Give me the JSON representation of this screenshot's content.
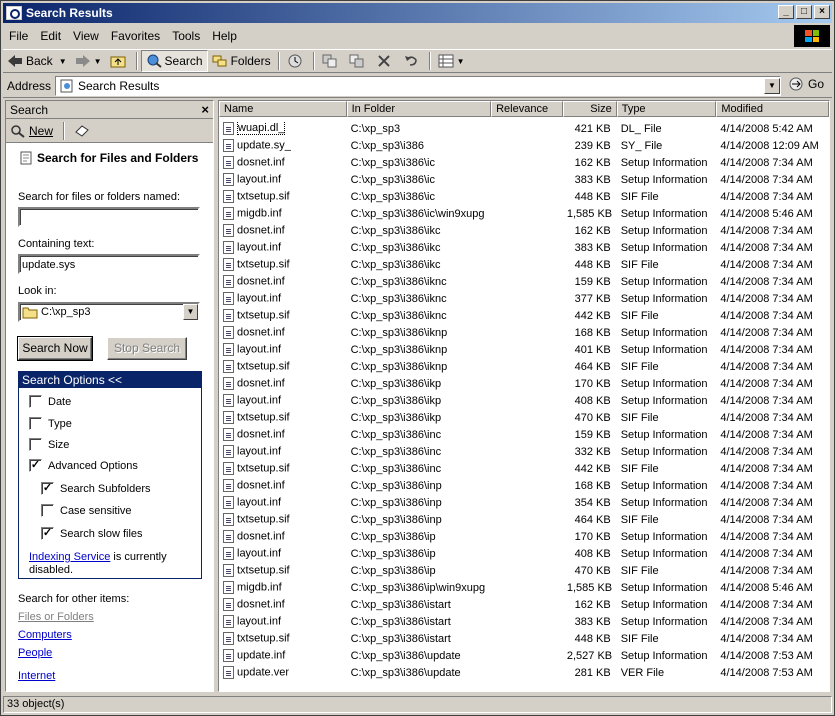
{
  "window": {
    "title": "Search Results"
  },
  "menu": [
    "File",
    "Edit",
    "View",
    "Favorites",
    "Tools",
    "Help"
  ],
  "toolbar": {
    "back": "Back",
    "search": "Search",
    "folders": "Folders"
  },
  "address": {
    "label": "Address",
    "value": "Search Results",
    "go": "Go"
  },
  "search_pane": {
    "title": "Search",
    "new_label": "New",
    "heading": "Search for Files and Folders",
    "name_label": "Search for files or folders named:",
    "name_value": "",
    "containing_label": "Containing text:",
    "containing_value": "update.sys",
    "lookin_label": "Look in:",
    "lookin_value": "C:\\xp_sp3",
    "search_now": "Search Now",
    "stop_search": "Stop Search",
    "options_title": "Search Options <<",
    "options": [
      {
        "label": "Date",
        "checked": false
      },
      {
        "label": "Type",
        "checked": false
      },
      {
        "label": "Size",
        "checked": false
      },
      {
        "label": "Advanced Options",
        "checked": true
      }
    ],
    "advanced": [
      {
        "label": "Search Subfolders",
        "checked": true
      },
      {
        "label": "Case sensitive",
        "checked": false
      },
      {
        "label": "Search slow files",
        "checked": true
      }
    ],
    "indexing_link": "Indexing Service",
    "indexing_text": " is currently disabled.",
    "other_label": "Search for other items:",
    "other_items": [
      "Files or Folders",
      "Computers",
      "People",
      "Internet"
    ]
  },
  "columns": [
    "Name",
    "In Folder",
    "Relevance",
    "Size",
    "Type",
    "Modified"
  ],
  "files": [
    [
      "wuapi.dl_",
      "C:\\xp_sp3",
      "",
      "421 KB",
      "DL_ File",
      "4/14/2008 5:42 AM"
    ],
    [
      "update.sy_",
      "C:\\xp_sp3\\i386",
      "",
      "239 KB",
      "SY_ File",
      "4/14/2008 12:09 AM"
    ],
    [
      "dosnet.inf",
      "C:\\xp_sp3\\i386\\ic",
      "",
      "162 KB",
      "Setup Information",
      "4/14/2008 7:34 AM"
    ],
    [
      "layout.inf",
      "C:\\xp_sp3\\i386\\ic",
      "",
      "383 KB",
      "Setup Information",
      "4/14/2008 7:34 AM"
    ],
    [
      "txtsetup.sif",
      "C:\\xp_sp3\\i386\\ic",
      "",
      "448 KB",
      "SIF File",
      "4/14/2008 7:34 AM"
    ],
    [
      "migdb.inf",
      "C:\\xp_sp3\\i386\\ic\\win9xupg",
      "",
      "1,585 KB",
      "Setup Information",
      "4/14/2008 5:46 AM"
    ],
    [
      "dosnet.inf",
      "C:\\xp_sp3\\i386\\ikc",
      "",
      "162 KB",
      "Setup Information",
      "4/14/2008 7:34 AM"
    ],
    [
      "layout.inf",
      "C:\\xp_sp3\\i386\\ikc",
      "",
      "383 KB",
      "Setup Information",
      "4/14/2008 7:34 AM"
    ],
    [
      "txtsetup.sif",
      "C:\\xp_sp3\\i386\\ikc",
      "",
      "448 KB",
      "SIF File",
      "4/14/2008 7:34 AM"
    ],
    [
      "dosnet.inf",
      "C:\\xp_sp3\\i386\\iknc",
      "",
      "159 KB",
      "Setup Information",
      "4/14/2008 7:34 AM"
    ],
    [
      "layout.inf",
      "C:\\xp_sp3\\i386\\iknc",
      "",
      "377 KB",
      "Setup Information",
      "4/14/2008 7:34 AM"
    ],
    [
      "txtsetup.sif",
      "C:\\xp_sp3\\i386\\iknc",
      "",
      "442 KB",
      "SIF File",
      "4/14/2008 7:34 AM"
    ],
    [
      "dosnet.inf",
      "C:\\xp_sp3\\i386\\iknp",
      "",
      "168 KB",
      "Setup Information",
      "4/14/2008 7:34 AM"
    ],
    [
      "layout.inf",
      "C:\\xp_sp3\\i386\\iknp",
      "",
      "401 KB",
      "Setup Information",
      "4/14/2008 7:34 AM"
    ],
    [
      "txtsetup.sif",
      "C:\\xp_sp3\\i386\\iknp",
      "",
      "464 KB",
      "SIF File",
      "4/14/2008 7:34 AM"
    ],
    [
      "dosnet.inf",
      "C:\\xp_sp3\\i386\\ikp",
      "",
      "170 KB",
      "Setup Information",
      "4/14/2008 7:34 AM"
    ],
    [
      "layout.inf",
      "C:\\xp_sp3\\i386\\ikp",
      "",
      "408 KB",
      "Setup Information",
      "4/14/2008 7:34 AM"
    ],
    [
      "txtsetup.sif",
      "C:\\xp_sp3\\i386\\ikp",
      "",
      "470 KB",
      "SIF File",
      "4/14/2008 7:34 AM"
    ],
    [
      "dosnet.inf",
      "C:\\xp_sp3\\i386\\inc",
      "",
      "159 KB",
      "Setup Information",
      "4/14/2008 7:34 AM"
    ],
    [
      "layout.inf",
      "C:\\xp_sp3\\i386\\inc",
      "",
      "332 KB",
      "Setup Information",
      "4/14/2008 7:34 AM"
    ],
    [
      "txtsetup.sif",
      "C:\\xp_sp3\\i386\\inc",
      "",
      "442 KB",
      "SIF File",
      "4/14/2008 7:34 AM"
    ],
    [
      "dosnet.inf",
      "C:\\xp_sp3\\i386\\inp",
      "",
      "168 KB",
      "Setup Information",
      "4/14/2008 7:34 AM"
    ],
    [
      "layout.inf",
      "C:\\xp_sp3\\i386\\inp",
      "",
      "354 KB",
      "Setup Information",
      "4/14/2008 7:34 AM"
    ],
    [
      "txtsetup.sif",
      "C:\\xp_sp3\\i386\\inp",
      "",
      "464 KB",
      "SIF File",
      "4/14/2008 7:34 AM"
    ],
    [
      "dosnet.inf",
      "C:\\xp_sp3\\i386\\ip",
      "",
      "170 KB",
      "Setup Information",
      "4/14/2008 7:34 AM"
    ],
    [
      "layout.inf",
      "C:\\xp_sp3\\i386\\ip",
      "",
      "408 KB",
      "Setup Information",
      "4/14/2008 7:34 AM"
    ],
    [
      "txtsetup.sif",
      "C:\\xp_sp3\\i386\\ip",
      "",
      "470 KB",
      "SIF File",
      "4/14/2008 7:34 AM"
    ],
    [
      "migdb.inf",
      "C:\\xp_sp3\\i386\\ip\\win9xupg",
      "",
      "1,585 KB",
      "Setup Information",
      "4/14/2008 5:46 AM"
    ],
    [
      "dosnet.inf",
      "C:\\xp_sp3\\i386\\istart",
      "",
      "162 KB",
      "Setup Information",
      "4/14/2008 7:34 AM"
    ],
    [
      "layout.inf",
      "C:\\xp_sp3\\i386\\istart",
      "",
      "383 KB",
      "Setup Information",
      "4/14/2008 7:34 AM"
    ],
    [
      "txtsetup.sif",
      "C:\\xp_sp3\\i386\\istart",
      "",
      "448 KB",
      "SIF File",
      "4/14/2008 7:34 AM"
    ],
    [
      "update.inf",
      "C:\\xp_sp3\\i386\\update",
      "",
      "2,527 KB",
      "Setup Information",
      "4/14/2008 7:53 AM"
    ],
    [
      "update.ver",
      "C:\\xp_sp3\\i386\\update",
      "",
      "281 KB",
      "VER File",
      "4/14/2008 7:53 AM"
    ]
  ],
  "status": {
    "count": "33 object(s)"
  },
  "colors": {
    "title_start": "#0a246a",
    "title_end": "#a6caf0",
    "link": "#0000cc",
    "face": "#d4d0c8"
  }
}
